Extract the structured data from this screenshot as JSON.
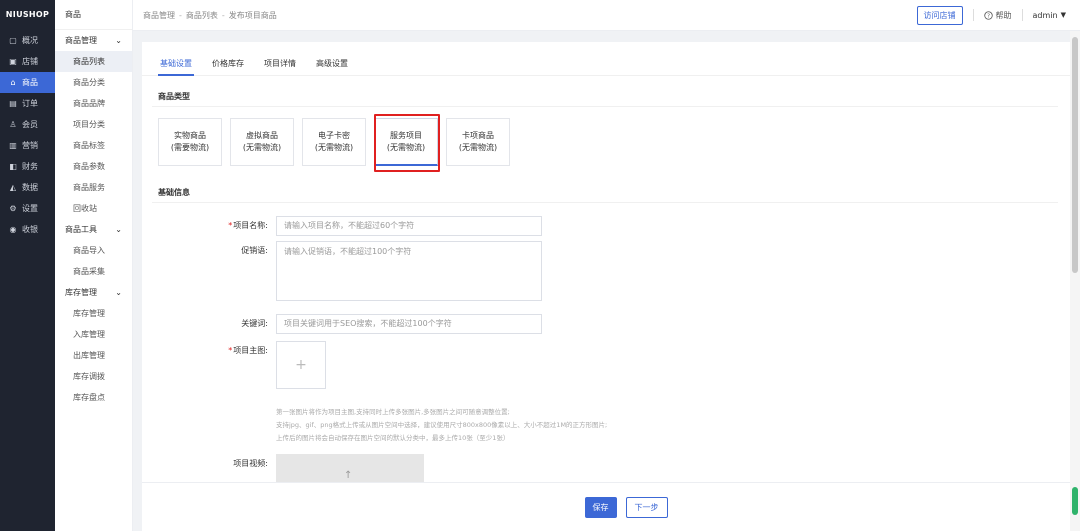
{
  "brand": "NIUSHOP",
  "nav_main": [
    {
      "label": "概况",
      "icon": "dashboard-icon"
    },
    {
      "label": "店铺",
      "icon": "store-icon"
    },
    {
      "label": "商品",
      "icon": "goods-icon",
      "active": true
    },
    {
      "label": "订单",
      "icon": "order-icon"
    },
    {
      "label": "会员",
      "icon": "member-icon"
    },
    {
      "label": "营销",
      "icon": "marketing-icon"
    },
    {
      "label": "财务",
      "icon": "finance-icon"
    },
    {
      "label": "数据",
      "icon": "data-icon"
    },
    {
      "label": "设置",
      "icon": "settings-icon"
    },
    {
      "label": "收银",
      "icon": "cashier-icon"
    }
  ],
  "nav_sub": {
    "head": "商品",
    "groups": [
      {
        "label": "商品管理",
        "items": [
          "商品列表",
          "商品分类",
          "商品品牌",
          "项目分类",
          "商品标签",
          "商品参数",
          "商品服务",
          "回收站"
        ]
      },
      {
        "label": "商品工具",
        "items": [
          "商品导入",
          "商品采集"
        ]
      },
      {
        "label": "库存管理",
        "items": [
          "库存管理",
          "入库管理",
          "出库管理",
          "库存调拨",
          "库存盘点"
        ]
      }
    ]
  },
  "breadcrumb": [
    "商品管理",
    "商品列表",
    "发布项目商品"
  ],
  "header": {
    "visit_store": "访问店铺",
    "help": "帮助",
    "user": "admin"
  },
  "tabs": [
    "基础设置",
    "价格库存",
    "项目详情",
    "高级设置"
  ],
  "sections": {
    "type": "商品类型",
    "basic": "基础信息"
  },
  "types": [
    {
      "name": "实物商品",
      "desc": "(需要物流)"
    },
    {
      "name": "虚拟商品",
      "desc": "(无需物流)"
    },
    {
      "name": "电子卡密",
      "desc": "(无需物流)"
    },
    {
      "name": "服务项目",
      "desc": "(无需物流)",
      "selected": true
    },
    {
      "name": "卡项商品",
      "desc": "(无需物流)"
    }
  ],
  "form": {
    "name_label": "项目名称:",
    "name_placeholder": "请输入项目名称，不能超过60个字符",
    "promo_label": "促销语:",
    "promo_placeholder": "请输入促销语，不能超过100个字符",
    "keyword_label": "关键词:",
    "keyword_placeholder": "项目关键词用于SEO搜索，不能超过100个字符",
    "image_label": "项目主图:",
    "video_label": "项目视频:"
  },
  "hints": [
    "第一张图片将作为项目主图,支持同时上传多张图片,多张图片之间可随意调整位置;",
    "支持jpg、gif、png格式上传或从图片空间中选择，建议使用尺寸800x800像素以上、大小不超过1M的正方形图片;",
    "上传后的图片将会自动保存在图片空间的默认分类中，最多上传10张（至少1张）"
  ],
  "actions": {
    "save": "保存",
    "next": "下一步"
  },
  "colors": {
    "accent": "#3c68d6",
    "sidebar": "#1f2430",
    "highlight": "#e02020"
  }
}
